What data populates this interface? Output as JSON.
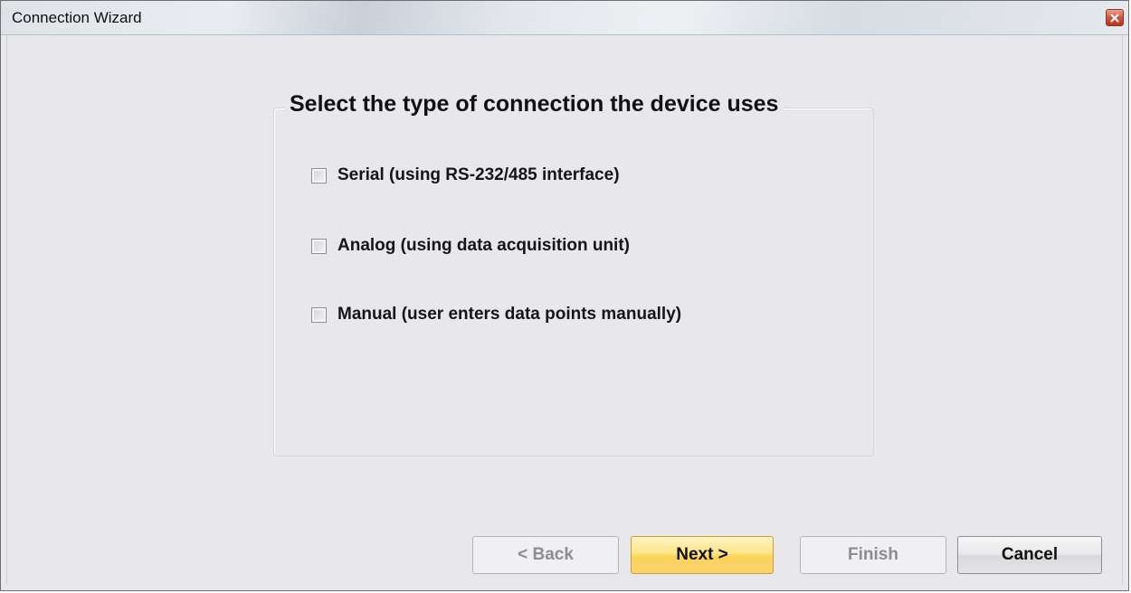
{
  "window": {
    "title": "Connection Wizard"
  },
  "group": {
    "title": "Select the type of connection the device uses",
    "options": [
      {
        "label": "Serial (using RS-232/485 interface)",
        "checked": false
      },
      {
        "label": "Analog (using data acquisition unit)",
        "checked": false
      },
      {
        "label": "Manual (user enters data points manually)",
        "checked": false
      }
    ]
  },
  "buttons": {
    "back": {
      "label": "< Back",
      "enabled": false
    },
    "next": {
      "label": "Next >",
      "enabled": true,
      "highlighted": true
    },
    "finish": {
      "label": "Finish",
      "enabled": false
    },
    "cancel": {
      "label": "Cancel",
      "enabled": true
    }
  },
  "icons": {
    "close": "close-icon"
  },
  "colors": {
    "next_button": "#fde589",
    "close_button": "#c9503a"
  }
}
